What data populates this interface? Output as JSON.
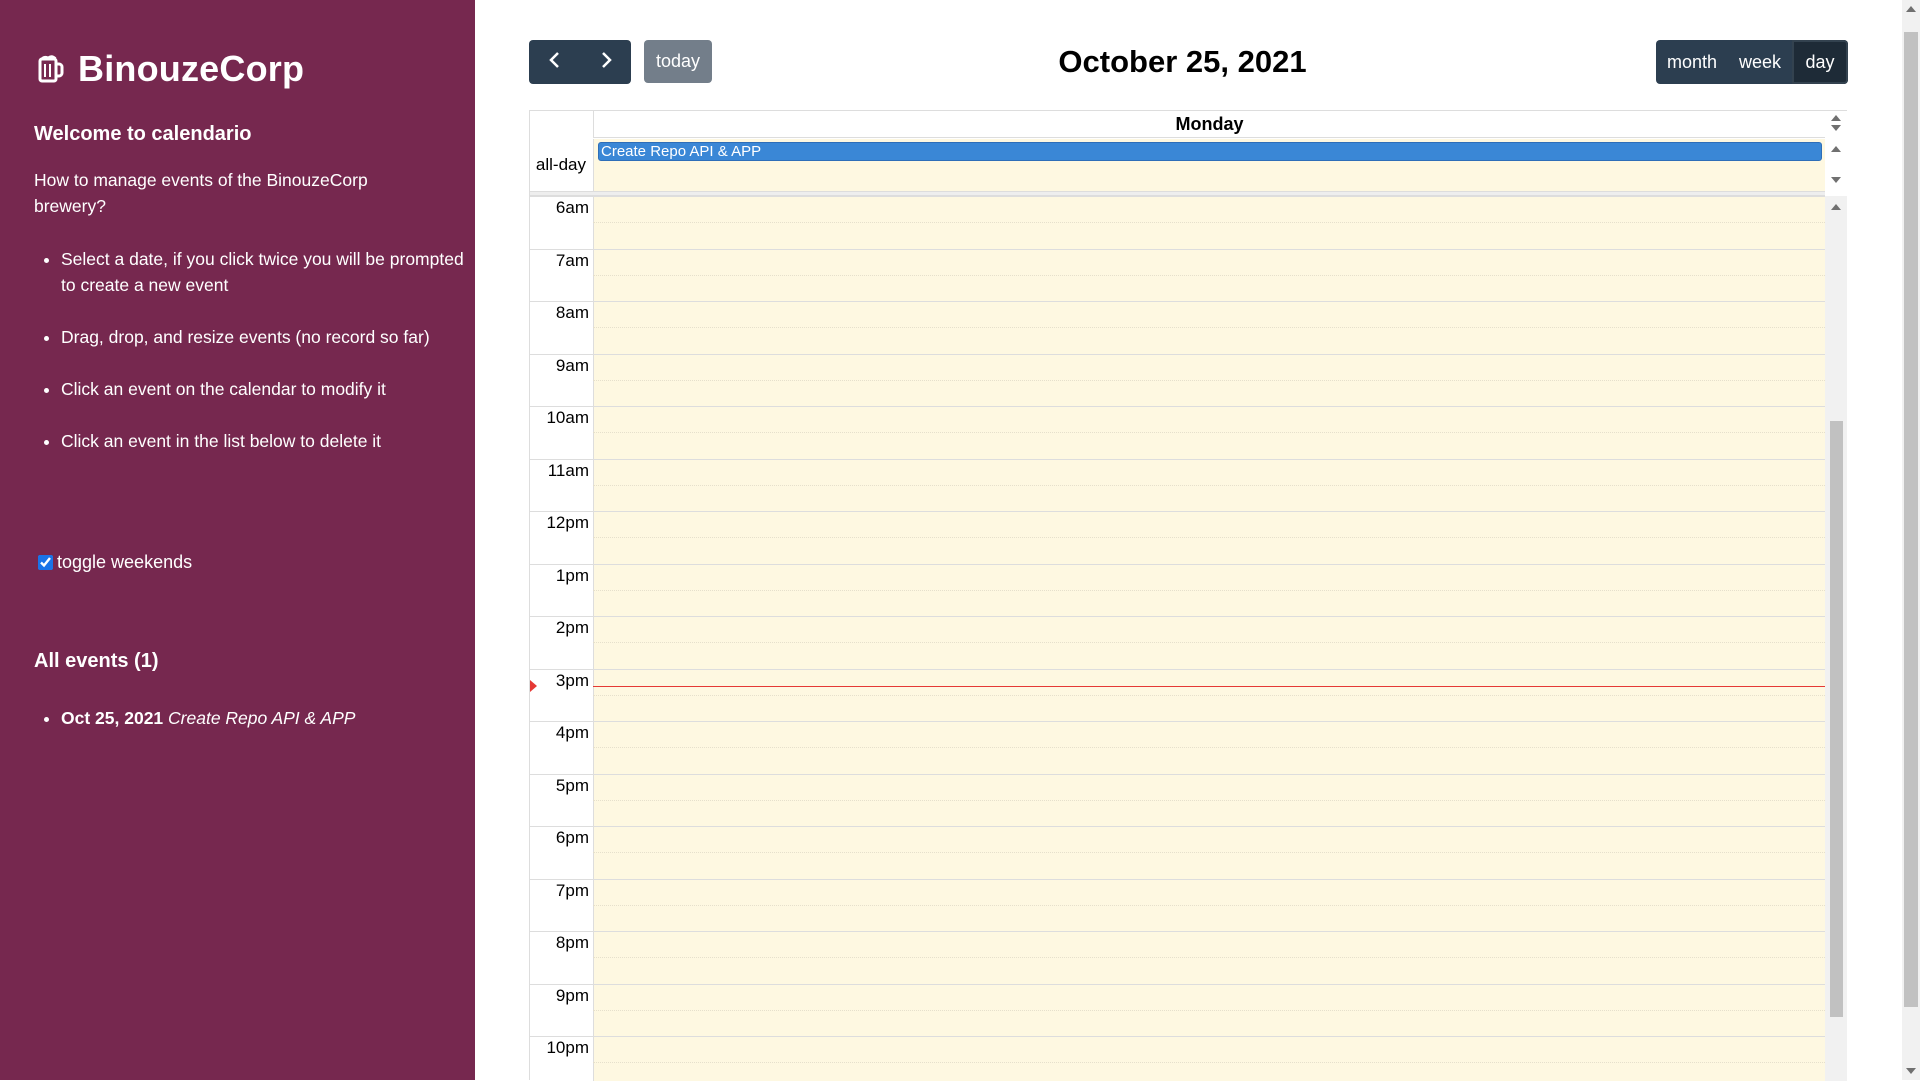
{
  "sidebar": {
    "brand": "BinouzeCorp",
    "brand_icon": "beer-mug-icon",
    "welcome_title": "Welcome to calendario",
    "intro": "How to manage events of the BinouzeCorp brewery?",
    "instructions": [
      "Select a date, if you click twice you will be prompted to create a new event",
      "Drag, drop, and resize events (no record so far)",
      "Click an event on the calendar to modify it",
      "Click an event in the list below to delete it"
    ],
    "toggle_label": "toggle weekends",
    "toggle_checked": true,
    "events_title": "All events (1)",
    "events": [
      {
        "date": "Oct 25, 2021",
        "title": "Create Repo API & APP"
      }
    ],
    "background_color": "#76284f"
  },
  "toolbar": {
    "prev_icon": "chevron-left-icon",
    "next_icon": "chevron-right-icon",
    "today_label": "today",
    "title": "October 25, 2021",
    "views": {
      "month": "month",
      "week": "week",
      "day": "day"
    },
    "active_view": "day",
    "button_color": "#2c3e50"
  },
  "calendar": {
    "day_header": "Monday",
    "allday_label": "all-day",
    "allday_events": [
      {
        "title": "Create Repo API & APP",
        "color": "#3a87d6"
      }
    ],
    "hours": [
      "6am",
      "7am",
      "8am",
      "9am",
      "10am",
      "11am",
      "12pm",
      "1pm",
      "2pm",
      "3pm",
      "4pm",
      "5pm",
      "6pm",
      "7pm",
      "8pm",
      "9pm",
      "10pm"
    ],
    "now_indicator_time": "3:20pm",
    "now_color": "#e53935",
    "today_bg": "#fef8e1"
  }
}
